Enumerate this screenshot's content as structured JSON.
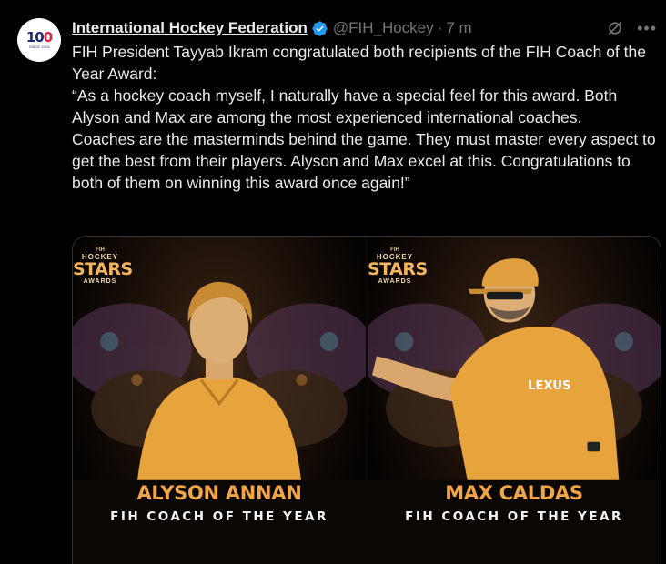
{
  "tweet": {
    "avatar": {
      "badge_number": "100",
      "badge_caption": "SINCE 1924"
    },
    "author_name": "International Hockey Federation",
    "handle": "@FIH_Hockey",
    "separator": "·",
    "time": "7 m",
    "more_label": "•••",
    "paragraphs": [
      "FIH President Tayyab Ikram congratulated both recipients of the FIH Coach of the Year Award:",
      "“As a hockey coach myself, I naturally have a special feel for this award. Both Alyson and Max are among the most experienced international coaches.",
      "Coaches are the masterminds behind the game. They must master every aspect to get the best from their players. Alyson and Max excel at this. Congratulations to both of them on winning this award once again!”"
    ]
  },
  "media": {
    "logo": {
      "fih": "FIH",
      "hockey": "HOCKEY",
      "stars": "STARS",
      "awards": "AWARDS"
    },
    "panels": [
      {
        "name": "ALYSON ANNAN",
        "role": "FIH COACH OF THE YEAR"
      },
      {
        "name": "MAX CALDAS",
        "role": "FIH COACH OF THE YEAR"
      }
    ]
  },
  "colors": {
    "background": "#000000",
    "text": "#e7e9ea",
    "muted": "#71767b",
    "verified": "#1d9bf0",
    "award_gold": "#f0a646"
  },
  "icons": [
    "verified-badge-icon",
    "grok-icon",
    "more-icon"
  ]
}
